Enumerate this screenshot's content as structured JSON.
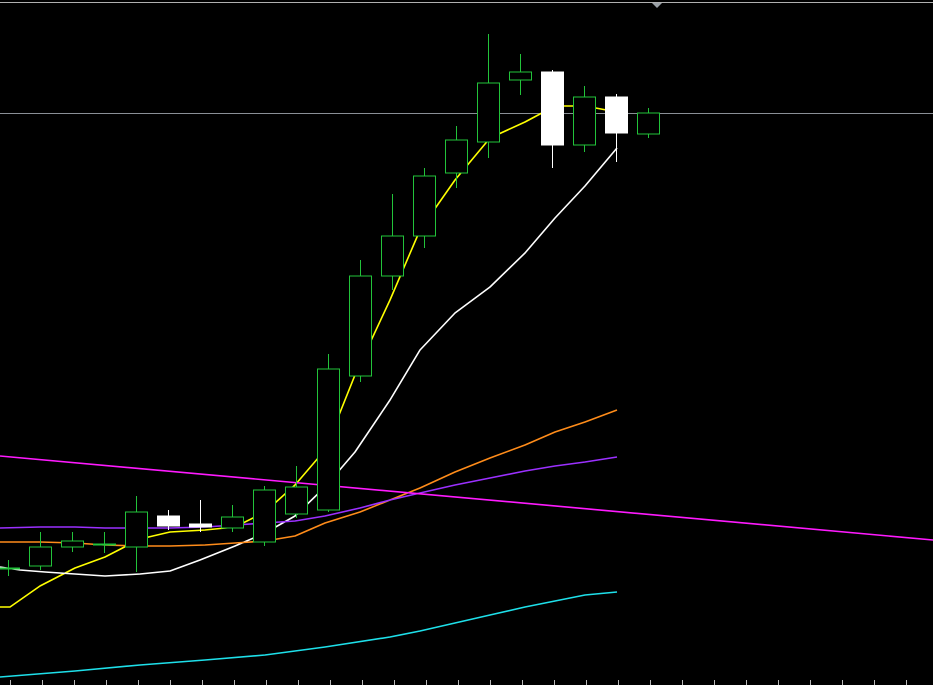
{
  "chart_data": {
    "type": "candlestick",
    "title": "",
    "xlabel": "",
    "ylabel": "",
    "ylim": [
      0,
      685
    ],
    "grid": false,
    "legend": "none",
    "price_line": 113,
    "colors": {
      "background": "#000000",
      "bull_outline": "#22c33a",
      "bear_fill": "#ffffff",
      "price_line": "#8a8f96",
      "top_border": "#b0b0b0"
    },
    "candles": [
      {
        "open": 568,
        "close": 568,
        "high": 560,
        "low": 576
      },
      {
        "open": 566,
        "close": 547,
        "high": 532,
        "low": 570
      },
      {
        "open": 547,
        "close": 541,
        "high": 532,
        "low": 552
      },
      {
        "open": 544,
        "close": 544,
        "high": 532,
        "low": 553
      },
      {
        "open": 547,
        "close": 512,
        "high": 496,
        "low": 572
      },
      {
        "open": 516,
        "close": 526,
        "high": 510,
        "low": 530
      },
      {
        "open": 524,
        "close": 527,
        "high": 500,
        "low": 532
      },
      {
        "open": 528,
        "close": 517,
        "high": 505,
        "low": 532
      },
      {
        "open": 542,
        "close": 490,
        "high": 486,
        "low": 546
      },
      {
        "open": 514,
        "close": 487,
        "high": 466,
        "low": 518
      },
      {
        "open": 510,
        "close": 369,
        "high": 354,
        "low": 512
      },
      {
        "open": 376,
        "close": 276,
        "high": 260,
        "low": 382
      },
      {
        "open": 276,
        "close": 236,
        "high": 194,
        "low": 290
      },
      {
        "open": 236,
        "close": 176,
        "high": 168,
        "low": 248
      },
      {
        "open": 173,
        "close": 140,
        "high": 126,
        "low": 188
      },
      {
        "open": 142,
        "close": 83,
        "high": 34,
        "low": 158
      },
      {
        "open": 80,
        "close": 72,
        "high": 54,
        "low": 95
      },
      {
        "open": 72,
        "close": 145,
        "high": 70,
        "low": 168
      },
      {
        "open": 145,
        "close": 97,
        "high": 86,
        "low": 152
      },
      {
        "open": 97,
        "close": 133,
        "high": 94,
        "low": 162
      },
      {
        "open": 134,
        "close": 113,
        "high": 108,
        "low": 138
      }
    ],
    "series": [
      {
        "type": "line",
        "color": "#ffff00",
        "points": [
          [
            0,
            607
          ],
          [
            10,
            607
          ],
          [
            40,
            586
          ],
          [
            75,
            568
          ],
          [
            105,
            557
          ],
          [
            140,
            539
          ],
          [
            170,
            532
          ],
          [
            205,
            530
          ],
          [
            235,
            527
          ],
          [
            265,
            512
          ],
          [
            295,
            485
          ],
          [
            325,
            450
          ],
          [
            355,
            375
          ],
          [
            390,
            300
          ],
          [
            420,
            230
          ],
          [
            455,
            180
          ],
          [
            490,
            138
          ],
          [
            525,
            122
          ],
          [
            555,
            106
          ],
          [
            585,
            106
          ],
          [
            617,
            112
          ]
        ]
      },
      {
        "type": "line",
        "color": "#ffffff",
        "points": [
          [
            0,
            567
          ],
          [
            20,
            570
          ],
          [
            45,
            572
          ],
          [
            75,
            574
          ],
          [
            105,
            576
          ],
          [
            140,
            574
          ],
          [
            170,
            571
          ],
          [
            200,
            560
          ],
          [
            235,
            546
          ],
          [
            265,
            533
          ],
          [
            295,
            516
          ],
          [
            325,
            487
          ],
          [
            355,
            452
          ],
          [
            390,
            400
          ],
          [
            420,
            350
          ],
          [
            455,
            313
          ],
          [
            490,
            287
          ],
          [
            525,
            253
          ],
          [
            555,
            218
          ],
          [
            585,
            186
          ],
          [
            617,
            148
          ]
        ]
      },
      {
        "type": "line",
        "color": "#ff8c1a",
        "points": [
          [
            0,
            542
          ],
          [
            40,
            542
          ],
          [
            75,
            543
          ],
          [
            105,
            545
          ],
          [
            140,
            546
          ],
          [
            170,
            546
          ],
          [
            205,
            545
          ],
          [
            235,
            543
          ],
          [
            265,
            541
          ],
          [
            295,
            536
          ],
          [
            325,
            523
          ],
          [
            360,
            512
          ],
          [
            390,
            500
          ],
          [
            420,
            488
          ],
          [
            455,
            472
          ],
          [
            490,
            458
          ],
          [
            525,
            445
          ],
          [
            555,
            432
          ],
          [
            585,
            422
          ],
          [
            617,
            410
          ]
        ]
      },
      {
        "type": "line",
        "color": "#9b30ff",
        "points": [
          [
            0,
            528
          ],
          [
            40,
            527
          ],
          [
            75,
            527
          ],
          [
            105,
            528
          ],
          [
            140,
            528
          ],
          [
            170,
            528
          ],
          [
            205,
            527
          ],
          [
            235,
            525
          ],
          [
            265,
            523
          ],
          [
            295,
            521
          ],
          [
            325,
            516
          ],
          [
            360,
            508
          ],
          [
            390,
            500
          ],
          [
            420,
            493
          ],
          [
            455,
            485
          ],
          [
            490,
            478
          ],
          [
            525,
            471
          ],
          [
            555,
            466
          ],
          [
            585,
            462
          ],
          [
            617,
            457
          ]
        ]
      },
      {
        "type": "line",
        "color": "#ff1aff",
        "points": [
          [
            0,
            456
          ],
          [
            933,
            540
          ]
        ]
      },
      {
        "type": "line",
        "color": "#1ee0ea",
        "points": [
          [
            0,
            677
          ],
          [
            75,
            671
          ],
          [
            140,
            665
          ],
          [
            205,
            660
          ],
          [
            265,
            655
          ],
          [
            325,
            647
          ],
          [
            390,
            637
          ],
          [
            420,
            631
          ],
          [
            455,
            623
          ],
          [
            490,
            615
          ],
          [
            525,
            607
          ],
          [
            555,
            601
          ],
          [
            585,
            595
          ],
          [
            617,
            592
          ]
        ]
      }
    ]
  }
}
